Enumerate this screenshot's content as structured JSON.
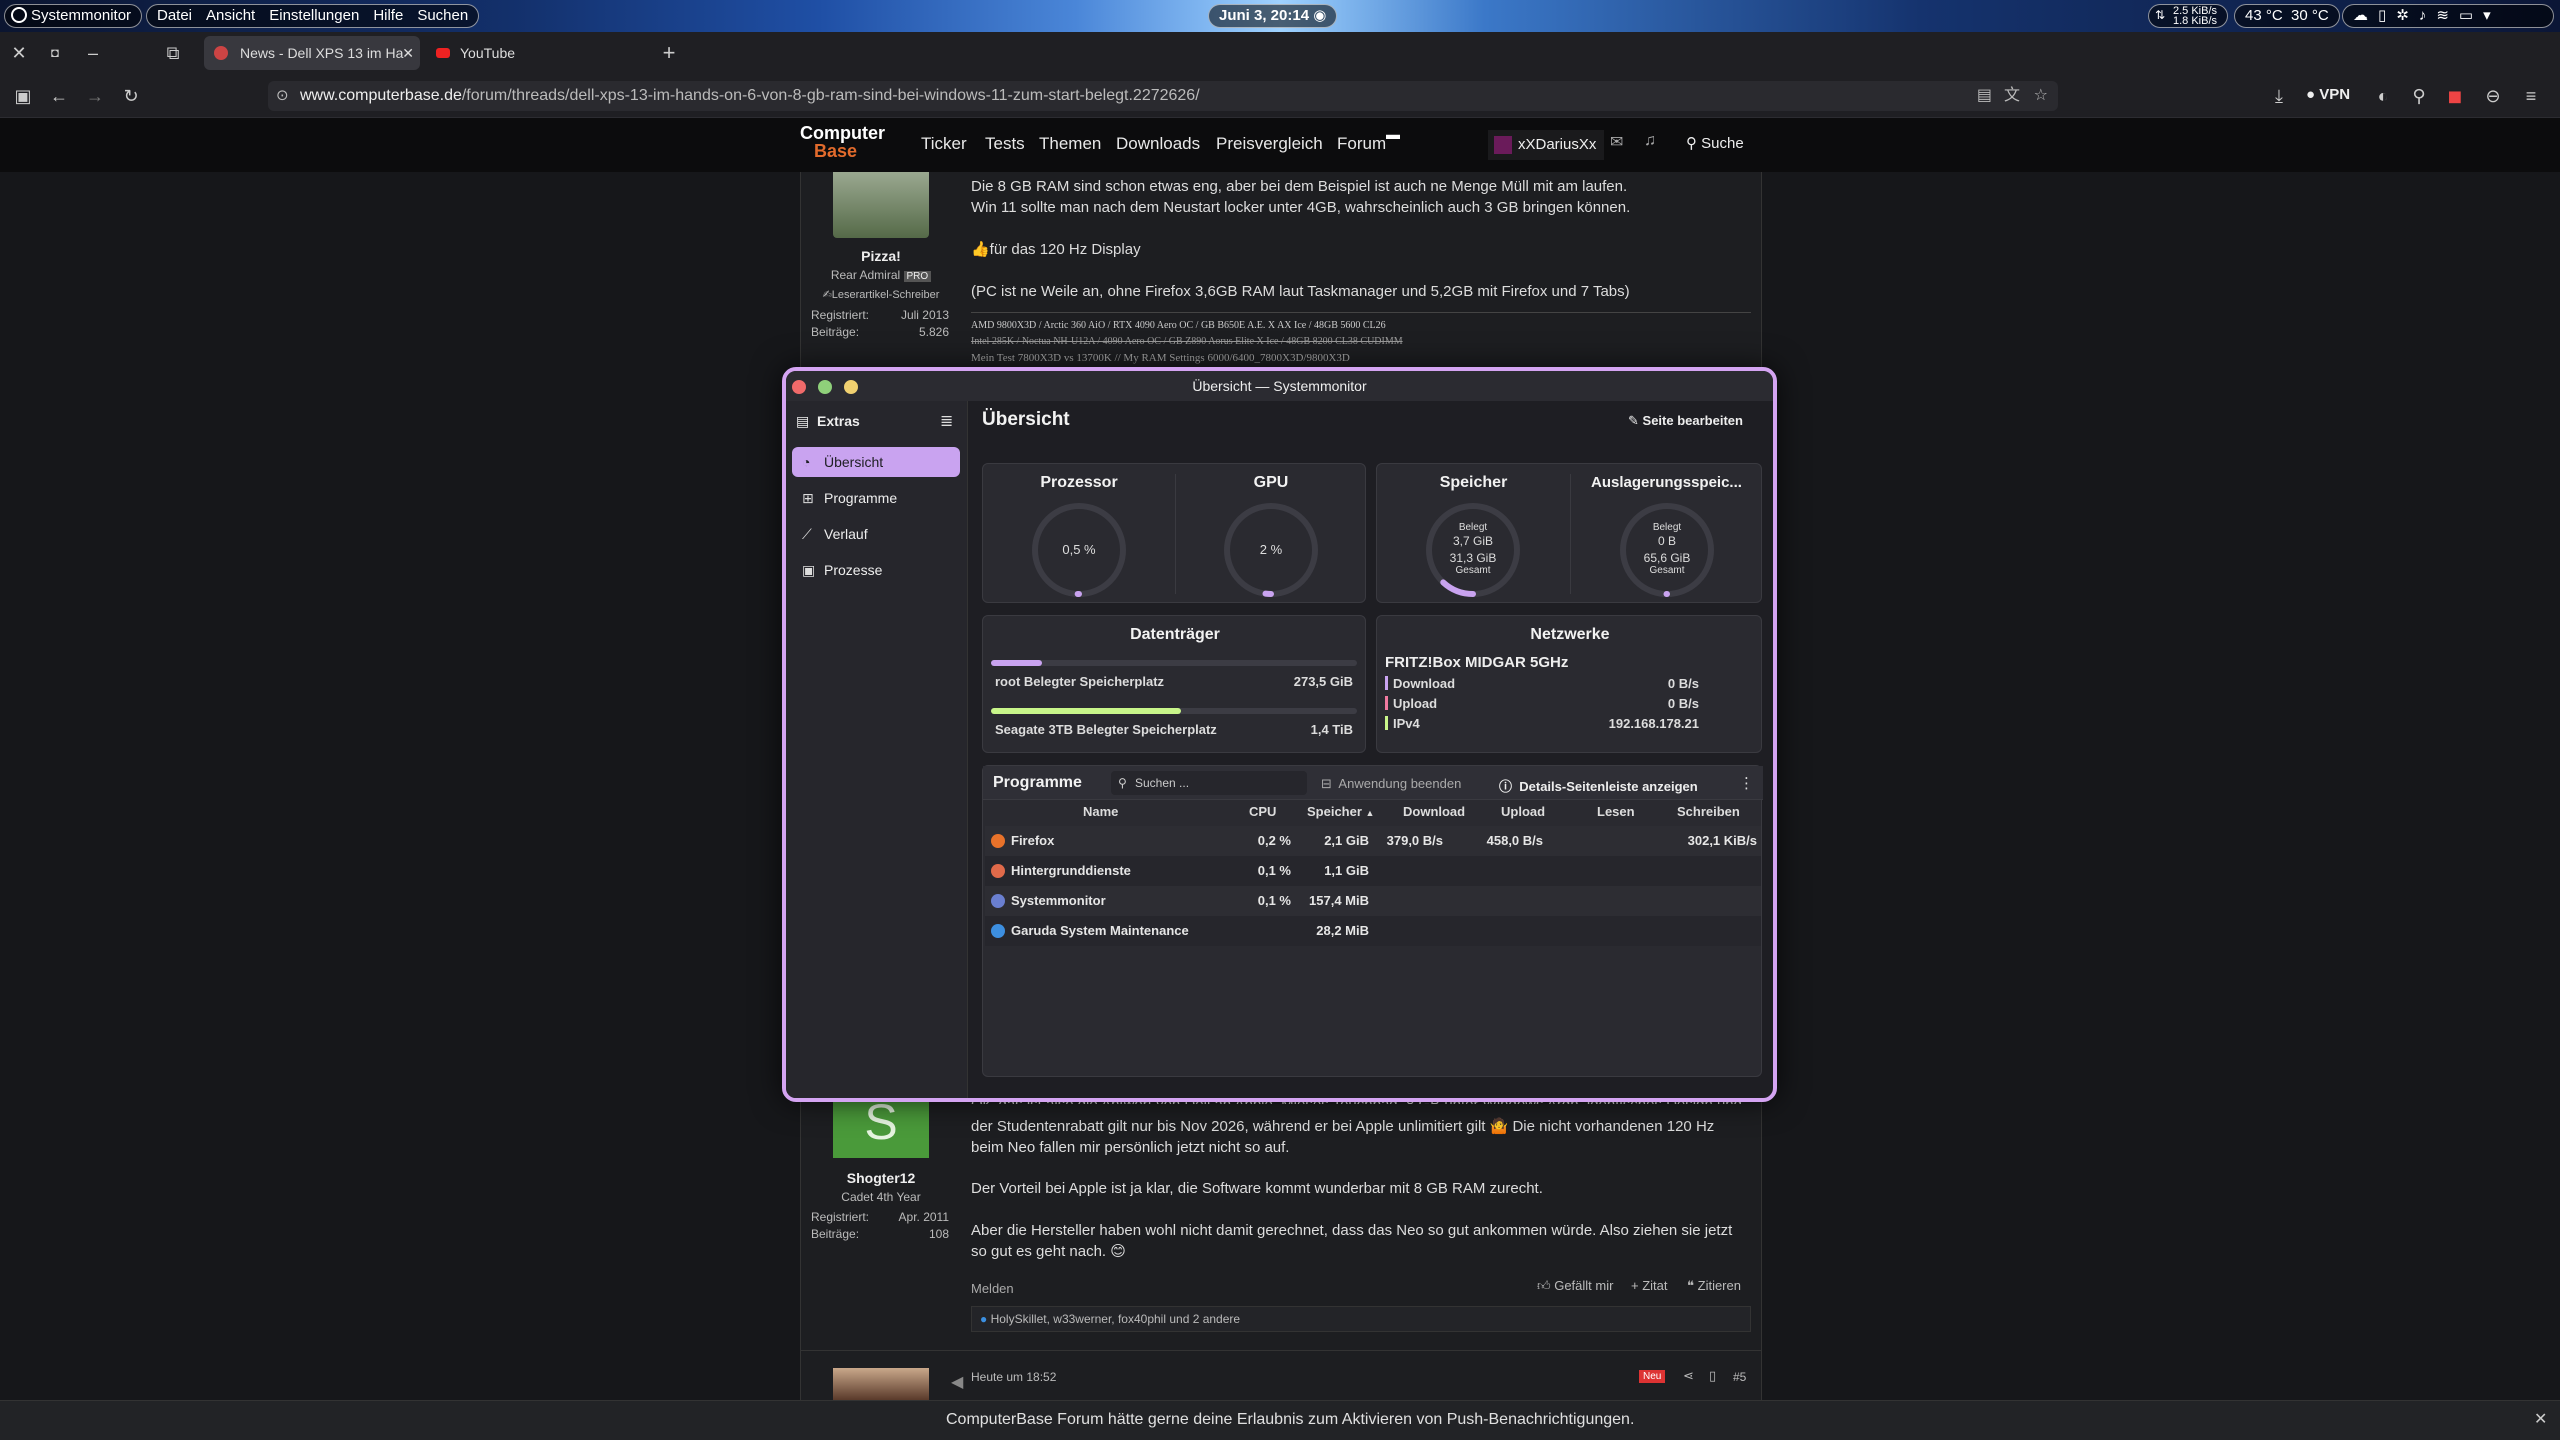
{
  "sysbar": {
    "app": "Systemmonitor",
    "menu": [
      "Datei",
      "Ansicht",
      "Einstellungen",
      "Hilfe",
      "Suchen"
    ],
    "clock": "Juni 3, 20:14",
    "net_up": "2.5 KiB/s",
    "net_down": "1.8 KiB/s",
    "temp_cpu": "43 °C",
    "temp_gpu": "30 °C"
  },
  "browser": {
    "tabs": [
      {
        "label": "News - Dell XPS 13 im Ha"
      },
      {
        "label": "YouTube"
      }
    ],
    "url_host": "www.computerbase.de",
    "url_path": "/forum/threads/dell-xps-13-im-hands-on-6-von-8-gb-ram-sind-bei-windows-11-zum-start-belegt.2272626/",
    "vpn": "VPN"
  },
  "site": {
    "logo_top": "Computer",
    "logo_bottom": "Base",
    "nav": [
      "Ticker",
      "Tests",
      "Themen",
      "Downloads",
      "Preisvergleich",
      "Forum"
    ],
    "user": "xXDariusXx",
    "search": "Suche"
  },
  "post1": {
    "user": "Pizza!",
    "rank": "Rear Admiral",
    "badge": "PRO",
    "role": "✍Leserartikel-Schreiber",
    "reg_label": "Registriert:",
    "reg_val": "Juli 2013",
    "posts_label": "Beiträge:",
    "posts_val": "5.826",
    "lines": [
      "Die 8 GB RAM sind schon etwas eng, aber bei dem Beispiel ist auch ne Menge Müll mit am laufen.",
      "Win 11 sollte man nach dem Neustart locker unter 4GB, wahrscheinlich auch 3 GB bringen können.",
      "👍für das 120 Hz Display",
      "(PC ist ne Weile an, ohne Firefox 3,6GB RAM laut Taskmanager und 5,2GB mit Firefox und 7 Tabs)"
    ],
    "sig": [
      "AMD 9800X3D / Arctic 360 AiO / RTX 4090 Aero OC / GB B650E A.E. X AX Ice / 48GB 5600 CL26",
      "Intel 285K / Noctua NH-U12A / 4090 Aero OC / GB Z890 Aorus Elite X Ice / 48GB 8200 CL38 CUDIMM",
      "Mein Test 7800X3D vs 13700K // My RAM Settings 6000/6400_7800X3D/9800X3D"
    ]
  },
  "post2": {
    "avatar_letter": "S",
    "user": "Shogter12",
    "rank": "Cadet 4th Year",
    "reg_label": "Registriert:",
    "reg_val": "Apr. 2011",
    "posts_label": "Beiträge:",
    "posts_val": "108",
    "lines": [
      "Ok, das ist also die Antwort von Dell an Apple. Mieses Touchpad, 8 GB unter Windows Argh, identisches Design und",
      "der Studentenrabatt gilt nur bis Nov 2026, während er bei Apple unlimitiert gilt 🤷 Die nicht vorhandenen 120 Hz",
      "beim Neo fallen mir persönlich jetzt nicht so auf.",
      "Der Vorteil bei Apple ist ja klar, die Software kommt wunderbar mit 8 GB RAM zurecht.",
      "Aber die Hersteller haben wohl nicht damit gerechnet, dass das Neo so gut ankommen würde. Also ziehen sie jetzt",
      "so gut es geht nach. 😊"
    ],
    "report": "Melden",
    "like": "Gefällt mir",
    "quote": "+ Zitat",
    "cite": "Zitieren",
    "reactions": "HolySkillet, w33werner, fox40phil und 2 andere"
  },
  "post3": {
    "time": "Heute um 18:52",
    "new_badge": "Neu",
    "num": "#5"
  },
  "notify": "ComputerBase Forum hätte gerne deine Erlaubnis zum Aktivieren von Push-Benachrichtigungen.",
  "sm": {
    "title": "Übersicht — Systemmonitor",
    "extras": "Extras",
    "heading": "Übersicht",
    "edit": "Seite bearbeiten",
    "nav": [
      "Übersicht",
      "Programme",
      "Verlauf",
      "Prozesse"
    ],
    "cpu": {
      "title": "Prozessor",
      "value": "0,5 %",
      "fraction": 0.005
    },
    "gpu": {
      "title": "GPU",
      "value": "2 %",
      "fraction": 0.02
    },
    "mem": {
      "title": "Speicher",
      "used_label": "Belegt",
      "used": "3,7 GiB",
      "total": "31,3 GiB",
      "total_label": "Gesamt",
      "fraction": 0.118
    },
    "swap": {
      "title": "Auslagerungsspeic...",
      "used_label": "Belegt",
      "used": "0 B",
      "total": "65,6 GiB",
      "total_label": "Gesamt",
      "fraction": 0
    },
    "disks": {
      "title": "Datenträger",
      "items": [
        {
          "label": "root Belegter Speicherplatz",
          "value": "273,5 GiB",
          "fraction": 0.14,
          "color": "#c9a3f0"
        },
        {
          "label": "Seagate 3TB Belegter Speicherplatz",
          "value": "1,4 TiB",
          "fraction": 0.52,
          "color": "#c8f58a"
        }
      ]
    },
    "net": {
      "title": "Netzwerke",
      "ssid": "FRITZ!Box MIDGAR 5GHz",
      "rows": [
        {
          "label": "Download",
          "value": "0 B/s",
          "color": "#c9a3f0"
        },
        {
          "label": "Upload",
          "value": "0 B/s",
          "color": "#f07aa0"
        },
        {
          "label": "IPv4",
          "value": "192.168.178.21",
          "color": "#c8f58a"
        }
      ]
    },
    "programs": {
      "title": "Programme",
      "search": "Suchen ...",
      "end": "Anwendung beenden",
      "details": "Details-Seitenleiste anzeigen",
      "columns": [
        "Name",
        "CPU",
        "Speicher",
        "Download",
        "Upload",
        "Lesen",
        "Schreiben"
      ],
      "rows": [
        {
          "name": "Firefox",
          "cpu": "0,2 %",
          "mem": "2,1 GiB",
          "down": "379,0 B/s",
          "up": "458,0 B/s",
          "read": "",
          "write": "302,1 KiB/s",
          "color": "#e8722a"
        },
        {
          "name": "Hintergrunddienste",
          "cpu": "0,1 %",
          "mem": "1,1 GiB",
          "down": "",
          "up": "",
          "read": "",
          "write": "",
          "color": "#e06a4a"
        },
        {
          "name": "Systemmonitor",
          "cpu": "0,1 %",
          "mem": "157,4 MiB",
          "down": "",
          "up": "",
          "read": "",
          "write": "",
          "color": "#6a7fd0"
        },
        {
          "name": "Garuda System Maintenance",
          "cpu": "",
          "mem": "28,2 MiB",
          "down": "",
          "up": "",
          "read": "",
          "write": "",
          "color": "#3d8fe0"
        }
      ]
    }
  }
}
